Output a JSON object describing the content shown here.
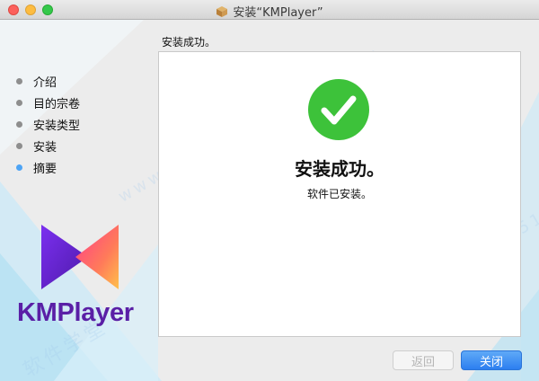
{
  "window": {
    "title": "安装“KMPlayer”"
  },
  "sidebar": {
    "steps": [
      {
        "label": "介绍",
        "active": false
      },
      {
        "label": "目的宗卷",
        "active": false
      },
      {
        "label": "安装类型",
        "active": false
      },
      {
        "label": "安装",
        "active": false
      },
      {
        "label": "摘要",
        "active": true
      }
    ],
    "brand": "KMPlayer"
  },
  "main": {
    "heading": "安装成功。",
    "success_title": "安装成功。",
    "success_subtitle": "软件已安装。"
  },
  "buttons": {
    "back_label": "返回",
    "close_label": "关闭"
  },
  "watermark": {
    "text1": "软件学堂",
    "text2": "www.xue51.com"
  },
  "colors": {
    "accent": "#2c7ff0",
    "success_green": "#3dc23a",
    "brand_purple": "#5a1fa6",
    "inactive_dot": "#8e8e8e",
    "active_dot": "#4da4f5"
  }
}
